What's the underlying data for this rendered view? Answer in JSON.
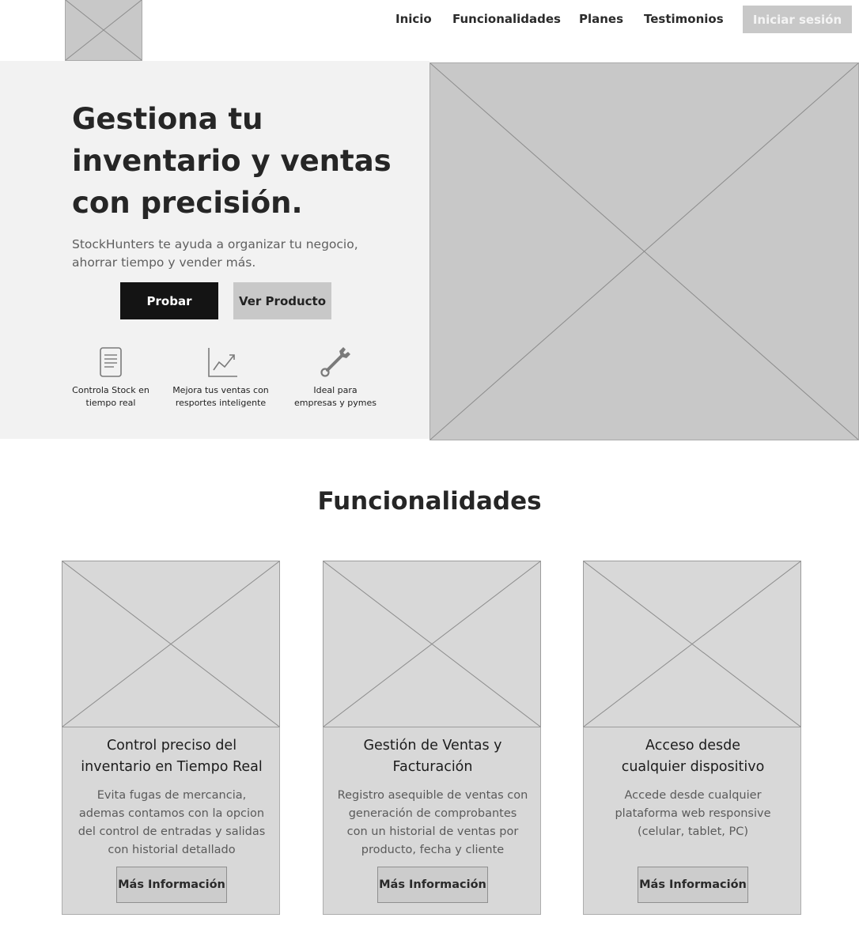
{
  "header": {
    "logo_icon": "image-placeholder-icon",
    "nav": [
      {
        "label": "Inicio"
      },
      {
        "label": "Funcionalidades"
      },
      {
        "label": "Planes"
      },
      {
        "label": "Testimonios"
      }
    ],
    "login_label": "Iniciar sesión"
  },
  "hero": {
    "title_lines": [
      "Gestiona tu",
      "inventario y ventas",
      "con precisión."
    ],
    "subtitle_lines": [
      "StockHunters te ayuda a organizar tu negocio,",
      "ahorrar tiempo y vender más."
    ],
    "primary_button": "Probar",
    "secondary_button": "Ver Producto",
    "features": [
      {
        "icon": "document-icon",
        "lines": [
          "Controla Stock en",
          "tiempo real"
        ]
      },
      {
        "icon": "chart-trend-icon",
        "lines": [
          "Mejora tus ventas con",
          "resportes inteligente"
        ]
      },
      {
        "icon": "wrench-icon",
        "lines": [
          "Ideal para",
          "empresas y pymes"
        ]
      }
    ],
    "image_icon": "image-placeholder-icon"
  },
  "features_section": {
    "title": "Funcionalidades",
    "cards": [
      {
        "title_lines": [
          "Control preciso del",
          "inventario en Tiempo Real"
        ],
        "desc_lines": [
          "Evita fugas de mercancia,",
          "ademas contamos con la opcion",
          "del control de entradas y salidas",
          "con historial detallado"
        ],
        "button": "Más Información"
      },
      {
        "title_lines": [
          "Gestión de Ventas y",
          "Facturación"
        ],
        "desc_lines": [
          "Registro asequible de ventas con",
          "generación de comprobantes",
          "con un historial de ventas por",
          "producto, fecha y cliente"
        ],
        "button": "Más Información"
      },
      {
        "title_lines": [
          "Acceso desde",
          "cualquier dispositivo"
        ],
        "desc_lines": [
          "Accede desde cualquier",
          "plataforma web responsive",
          "(celular, tablet, PC)"
        ],
        "button": "Más Información"
      }
    ]
  },
  "colors": {
    "primary_button_bg": "#141414",
    "placeholder_gray": "#c8c8c8",
    "hero_bg": "#f2f2f2",
    "card_bg": "#d8d8d8"
  }
}
